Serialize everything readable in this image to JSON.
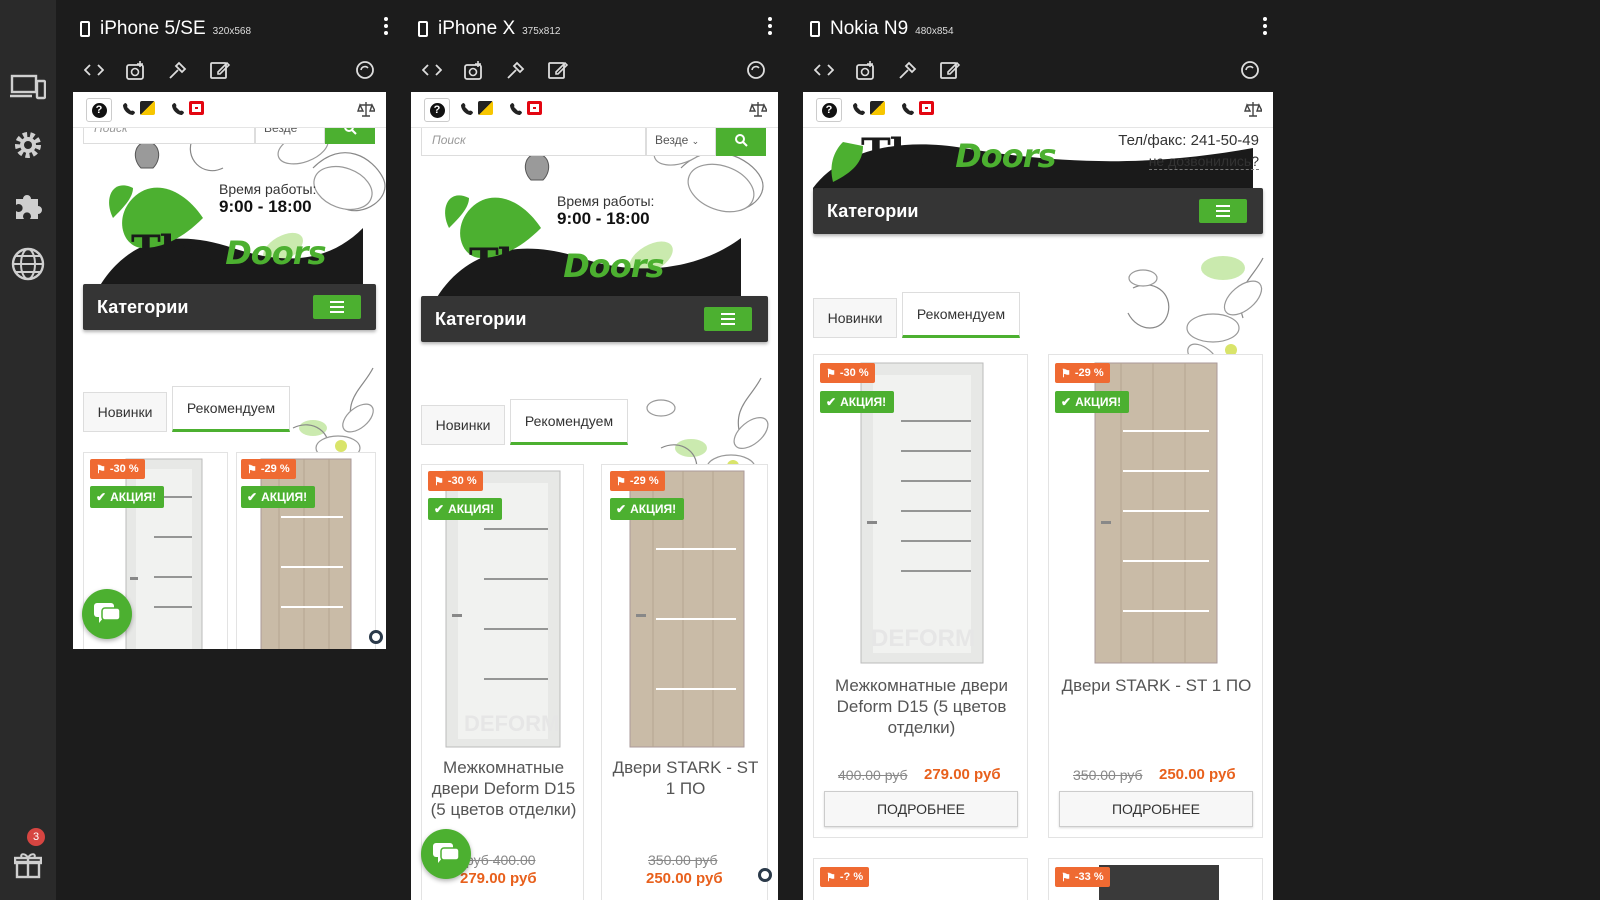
{
  "rail": {
    "items": [
      "devices-icon",
      "settings-icon",
      "extensions-icon",
      "globe-icon"
    ],
    "gift": {
      "icon": "gift-icon",
      "badge": "3"
    }
  },
  "devices": [
    {
      "name": "iPhone 5/SE",
      "size": "320x568"
    },
    {
      "name": "iPhone X",
      "size": "375x812"
    },
    {
      "name": "Nokia N9",
      "size": "480x854"
    }
  ],
  "site": {
    "search_placeholder": "Поиск",
    "search_scope": "Везде",
    "worktime_label": "Время работы:",
    "worktime_hours": "9:00 - 18:00",
    "logo_the": "The",
    "logo_doors": "Doors",
    "phone_fax": "Тел/факс: 241-50-49",
    "no_answer": "не дозвонились?",
    "categories": "Категории",
    "tabs": [
      "Новинки",
      "Рекомендуем"
    ],
    "sale_label": "АКЦИЯ!",
    "details_button": "ПОДРОБНЕЕ",
    "watermark": "DEFORM",
    "products": [
      {
        "discount": "-30 %",
        "title": "Межкомнатные двери Deform D15 (5 цветов отделки)",
        "old_price": "400.00 руб",
        "price": "279.00 руб"
      },
      {
        "discount": "-29 %",
        "title": "Двери STARK - ST 1 ПО",
        "old_price": "350.00 руб",
        "price": "250.00 руб"
      }
    ],
    "more_discounts": [
      "-? %",
      "-33 %"
    ]
  },
  "colors": {
    "accent": "#4cb030",
    "discount": "#ef6a32",
    "price": "#e8601c",
    "bar": "#353535"
  }
}
